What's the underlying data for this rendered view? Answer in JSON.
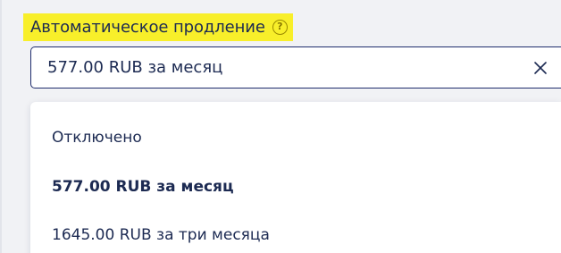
{
  "field": {
    "label": "Автоматическое продление",
    "help_glyph": "?",
    "selected_value": "577.00 RUB за месяц",
    "clear_icon": "close-icon"
  },
  "dropdown": {
    "options": [
      {
        "label": "Отключено",
        "selected": false
      },
      {
        "label": "577.00 RUB за месяц",
        "selected": true
      },
      {
        "label": "1645.00 RUB за три месяца",
        "selected": false
      }
    ]
  },
  "colors": {
    "highlight": "#f8ef2a",
    "text": "#1c2a52",
    "border": "#1f2d6d",
    "background": "#f1f2f5"
  }
}
